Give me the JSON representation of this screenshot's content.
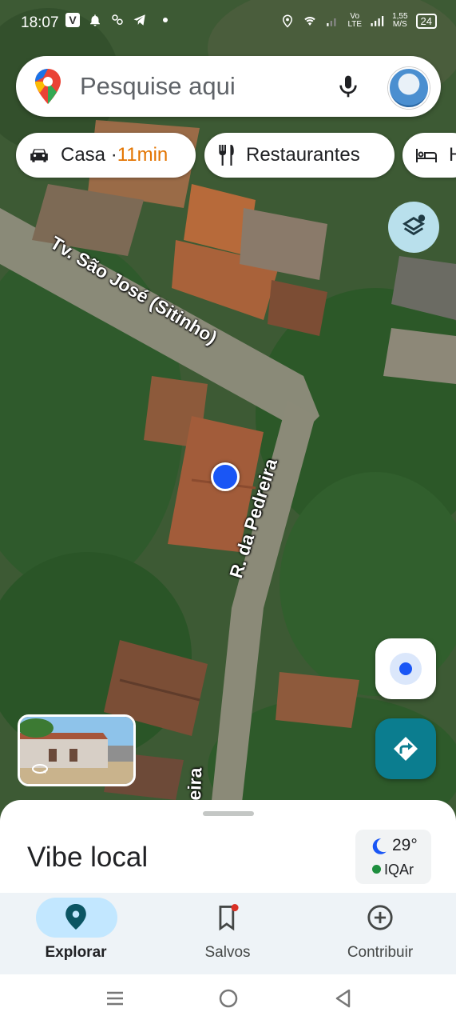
{
  "status_bar": {
    "time": "18:07",
    "net_speed_value": "1,55",
    "net_speed_unit": "M/S",
    "network_label_top": "Vo",
    "network_label_bottom": "LTE",
    "battery": "24"
  },
  "search": {
    "placeholder": "Pesquise aqui"
  },
  "chips": [
    {
      "label": "Casa · ",
      "time": "11min",
      "icon": "car-icon"
    },
    {
      "label": "Restaurantes",
      "icon": "fork-knife-icon"
    },
    {
      "label": "H",
      "icon": "bed-icon"
    }
  ],
  "map": {
    "road_labels": [
      "Tv. São José (Sitinho)",
      "R. da Pedreira",
      "eira"
    ]
  },
  "sheet": {
    "title": "Vibe local",
    "weather": {
      "temperature": "29°",
      "air_quality": "IQAr"
    }
  },
  "bottom_nav": [
    {
      "label": "Explorar",
      "icon": "explore-pin-icon",
      "active": true
    },
    {
      "label": "Salvos",
      "icon": "bookmark-icon",
      "active": false
    },
    {
      "label": "Contribuir",
      "icon": "add-circle-icon",
      "active": false
    }
  ],
  "colors": {
    "accent": "#0b7d8f",
    "user_location": "#1a56f5",
    "eta": "#e37400",
    "active_nav": "#c2e7ff"
  }
}
